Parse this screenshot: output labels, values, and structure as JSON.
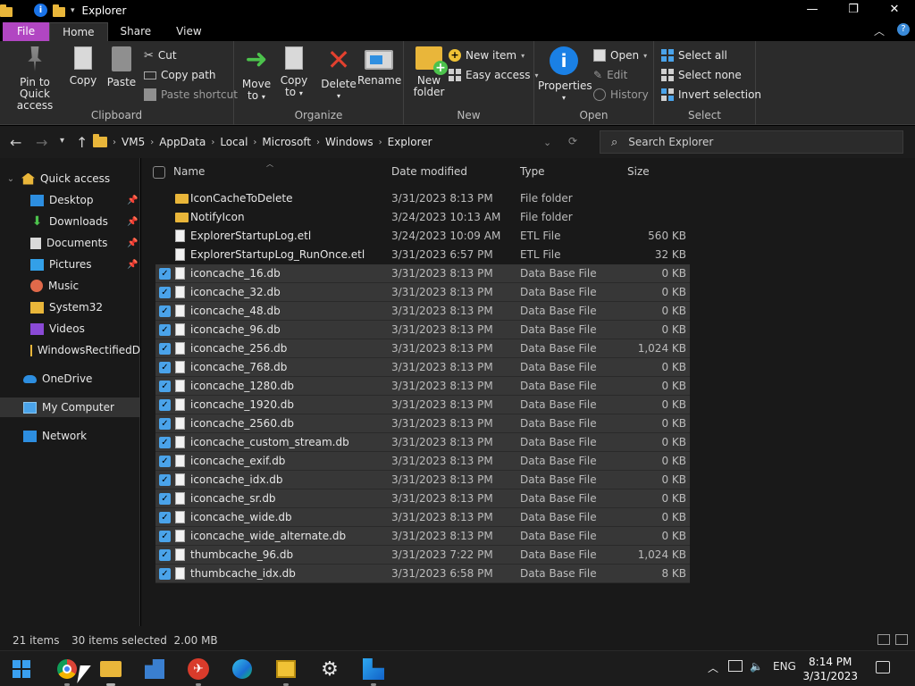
{
  "window": {
    "title": "Explorer",
    "controls": {
      "minimize": "—",
      "maximize": "❐",
      "close": "✕"
    }
  },
  "ribbon_tabs": [
    {
      "label": "File"
    },
    {
      "label": "Home"
    },
    {
      "label": "Share"
    },
    {
      "label": "View"
    }
  ],
  "ribbon": {
    "clipboard": {
      "label": "Clipboard",
      "pin": "Pin to Quick access",
      "pin_line1": "Pin to Quick",
      "pin_line2": "access",
      "copy": "Copy",
      "paste": "Paste",
      "cut": "Cut",
      "copy_path": "Copy path",
      "paste_shortcut": "Paste shortcut"
    },
    "organize": {
      "label": "Organize",
      "move_to_line1": "Move",
      "move_to_line2": "to",
      "copy_to_line1": "Copy",
      "copy_to_line2": "to",
      "delete": "Delete",
      "rename": "Rename"
    },
    "new": {
      "label": "New",
      "new_folder_line1": "New",
      "new_folder_line2": "folder",
      "new_item": "New item",
      "easy_access": "Easy access"
    },
    "open": {
      "label": "Open",
      "properties": "Properties",
      "open": "Open",
      "edit": "Edit",
      "history": "History"
    },
    "select": {
      "label": "Select",
      "select_all": "Select all",
      "select_none": "Select none",
      "invert_selection": "Invert selection"
    }
  },
  "address": {
    "crumbs": [
      "VM5",
      "AppData",
      "Local",
      "Microsoft",
      "Windows",
      "Explorer"
    ],
    "search_placeholder": "Search Explorer"
  },
  "nav_pane": [
    {
      "label": "Quick access",
      "icon": "star-icon"
    },
    {
      "label": "Desktop",
      "icon": "desktop-icon",
      "pinned": true
    },
    {
      "label": "Downloads",
      "icon": "download-icon",
      "pinned": true
    },
    {
      "label": "Documents",
      "icon": "documents-icon",
      "pinned": true
    },
    {
      "label": "Pictures",
      "icon": "pictures-icon",
      "pinned": true
    },
    {
      "label": "Music",
      "icon": "music-icon"
    },
    {
      "label": "System32",
      "icon": "folder-icon"
    },
    {
      "label": "Videos",
      "icon": "videos-icon"
    },
    {
      "label": "WindowsRectifiedD",
      "icon": "folder-icon"
    },
    {
      "label": "OneDrive",
      "icon": "cloud-icon"
    },
    {
      "label": "My Computer",
      "icon": "computer-icon"
    },
    {
      "label": "Network",
      "icon": "network-icon"
    }
  ],
  "columns": {
    "name": "Name",
    "date": "Date modified",
    "type": "Type",
    "size": "Size"
  },
  "files": [
    {
      "name": "IconCacheToDelete",
      "date": "3/31/2023 8:13 PM",
      "type": "File folder",
      "size": "",
      "kind": "folder",
      "selected": false
    },
    {
      "name": "NotifyIcon",
      "date": "3/24/2023 10:13 AM",
      "type": "File folder",
      "size": "",
      "kind": "folder",
      "selected": false
    },
    {
      "name": "ExplorerStartupLog.etl",
      "date": "3/24/2023 10:09 AM",
      "type": "ETL File",
      "size": "560 KB",
      "kind": "file",
      "selected": false
    },
    {
      "name": "ExplorerStartupLog_RunOnce.etl",
      "date": "3/31/2023 6:57 PM",
      "type": "ETL File",
      "size": "32 KB",
      "kind": "file",
      "selected": false
    },
    {
      "name": "iconcache_16.db",
      "date": "3/31/2023 8:13 PM",
      "type": "Data Base File",
      "size": "0 KB",
      "kind": "file",
      "selected": true
    },
    {
      "name": "iconcache_32.db",
      "date": "3/31/2023 8:13 PM",
      "type": "Data Base File",
      "size": "0 KB",
      "kind": "file",
      "selected": true
    },
    {
      "name": "iconcache_48.db",
      "date": "3/31/2023 8:13 PM",
      "type": "Data Base File",
      "size": "0 KB",
      "kind": "file",
      "selected": true
    },
    {
      "name": "iconcache_96.db",
      "date": "3/31/2023 8:13 PM",
      "type": "Data Base File",
      "size": "0 KB",
      "kind": "file",
      "selected": true
    },
    {
      "name": "iconcache_256.db",
      "date": "3/31/2023 8:13 PM",
      "type": "Data Base File",
      "size": "1,024 KB",
      "kind": "file",
      "selected": true
    },
    {
      "name": "iconcache_768.db",
      "date": "3/31/2023 8:13 PM",
      "type": "Data Base File",
      "size": "0 KB",
      "kind": "file",
      "selected": true
    },
    {
      "name": "iconcache_1280.db",
      "date": "3/31/2023 8:13 PM",
      "type": "Data Base File",
      "size": "0 KB",
      "kind": "file",
      "selected": true
    },
    {
      "name": "iconcache_1920.db",
      "date": "3/31/2023 8:13 PM",
      "type": "Data Base File",
      "size": "0 KB",
      "kind": "file",
      "selected": true
    },
    {
      "name": "iconcache_2560.db",
      "date": "3/31/2023 8:13 PM",
      "type": "Data Base File",
      "size": "0 KB",
      "kind": "file",
      "selected": true
    },
    {
      "name": "iconcache_custom_stream.db",
      "date": "3/31/2023 8:13 PM",
      "type": "Data Base File",
      "size": "0 KB",
      "kind": "file",
      "selected": true
    },
    {
      "name": "iconcache_exif.db",
      "date": "3/31/2023 8:13 PM",
      "type": "Data Base File",
      "size": "0 KB",
      "kind": "file",
      "selected": true
    },
    {
      "name": "iconcache_idx.db",
      "date": "3/31/2023 8:13 PM",
      "type": "Data Base File",
      "size": "0 KB",
      "kind": "file",
      "selected": true
    },
    {
      "name": "iconcache_sr.db",
      "date": "3/31/2023 8:13 PM",
      "type": "Data Base File",
      "size": "0 KB",
      "kind": "file",
      "selected": true
    },
    {
      "name": "iconcache_wide.db",
      "date": "3/31/2023 8:13 PM",
      "type": "Data Base File",
      "size": "0 KB",
      "kind": "file",
      "selected": true
    },
    {
      "name": "iconcache_wide_alternate.db",
      "date": "3/31/2023 8:13 PM",
      "type": "Data Base File",
      "size": "0 KB",
      "kind": "file",
      "selected": true
    },
    {
      "name": "thumbcache_96.db",
      "date": "3/31/2023 7:22 PM",
      "type": "Data Base File",
      "size": "1,024 KB",
      "kind": "file",
      "selected": true
    },
    {
      "name": "thumbcache_idx.db",
      "date": "3/31/2023 6:58 PM",
      "type": "Data Base File",
      "size": "8 KB",
      "kind": "file",
      "selected": true
    }
  ],
  "status": {
    "item_count": "21 items",
    "selection": "30 items selected  2.00 MB"
  },
  "taskbar": {
    "language": "ENG",
    "time": "8:14 PM",
    "date": "3/31/2023"
  },
  "colors": {
    "accent": "#4aa3ea",
    "file_tab": "#b146c2",
    "folder": "#e9b63a"
  }
}
